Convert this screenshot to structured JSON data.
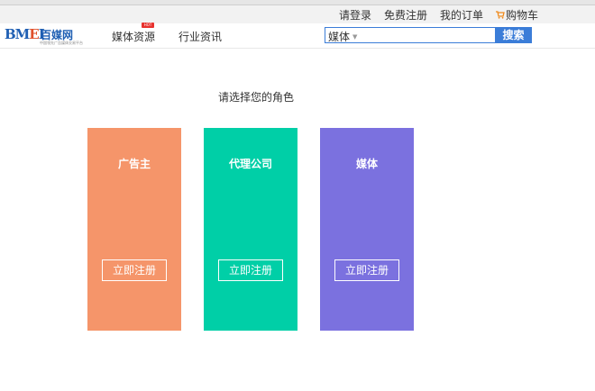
{
  "top_links": {
    "login": "请登录",
    "register": "免费注册",
    "orders": "我的订单",
    "cart": "购物车",
    "cart_icon": "shopping-cart-icon"
  },
  "logo": {
    "mark_b": "BM",
    "mark_e": "E",
    "mark_i": "I",
    "name": "百媒网",
    "tagline": "中国领先广告媒体交易平台"
  },
  "nav": {
    "items": [
      {
        "label": "媒体资源",
        "badge": "HOT"
      },
      {
        "label": "行业资讯"
      }
    ]
  },
  "search": {
    "category": "媒体",
    "placeholder": "",
    "button_label": "搜索"
  },
  "main": {
    "prompt": "请选择您的角色",
    "roles": [
      {
        "title": "广告主",
        "button": "立即注册",
        "color": "#f5956a"
      },
      {
        "title": "代理公司",
        "button": "立即注册",
        "color": "#00cfa7"
      },
      {
        "title": "媒体",
        "button": "立即注册",
        "color": "#7b71df"
      }
    ]
  },
  "colors": {
    "accent": "#3b7dd8",
    "hot_badge": "#e8322e"
  }
}
